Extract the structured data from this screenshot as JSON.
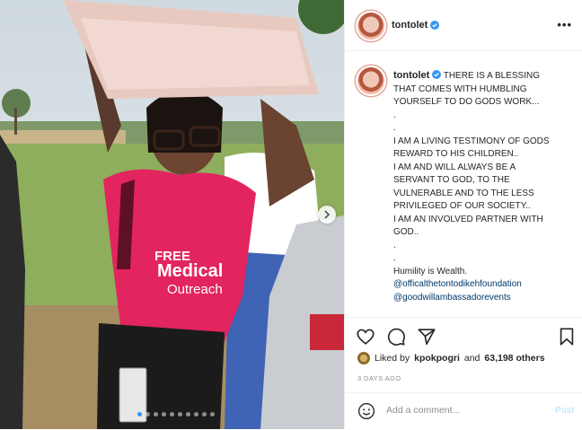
{
  "post": {
    "username": "tontolet",
    "more_icon": "•••"
  },
  "caption": {
    "username": "tontolet",
    "lines": [
      "THERE IS A BLESSING",
      "THAT COMES WITH HUMBLING",
      "YOURSELF TO DO GODS WORK...",
      ".",
      ".",
      "I AM A LIVING TESTIMONY OF GODS",
      "REWARD TO HIS CHILDREN..",
      "I AM AND WILL ALWAYS BE A",
      "SERVANT TO GOD, TO THE",
      "VULNERABLE AND TO THE LESS",
      "PRIVILEGED OF OUR SOCIETY..",
      "I AM AN INVOLVED PARTNER WITH",
      "GOD..",
      ".",
      ".",
      "Humility is Wealth."
    ],
    "tags": [
      "@officalthetontodikehfoundation",
      "@goodwillambassadorevents"
    ]
  },
  "likes": {
    "prefix": "Liked by",
    "user": "kpokpogri",
    "middle": "and",
    "count": "63,198 others"
  },
  "date": "3 DAYS AGO",
  "comment": {
    "placeholder": "Add a comment...",
    "post_label": "Post"
  },
  "photo": {
    "shirt_text_1": "FREE",
    "shirt_text_2": "Medical",
    "shirt_text_3": "Outreach"
  },
  "carousel": {
    "count": 10,
    "active": 0
  },
  "colors": {
    "accent": "#3897f0",
    "tag": "#00376b",
    "muted": "#8e8e8e",
    "post_disabled": "#b2dffc"
  },
  "icons": [
    "chevron-right-icon",
    "verified-badge-icon",
    "heart-icon",
    "comment-icon",
    "share-icon",
    "bookmark-icon",
    "emoji-icon"
  ]
}
